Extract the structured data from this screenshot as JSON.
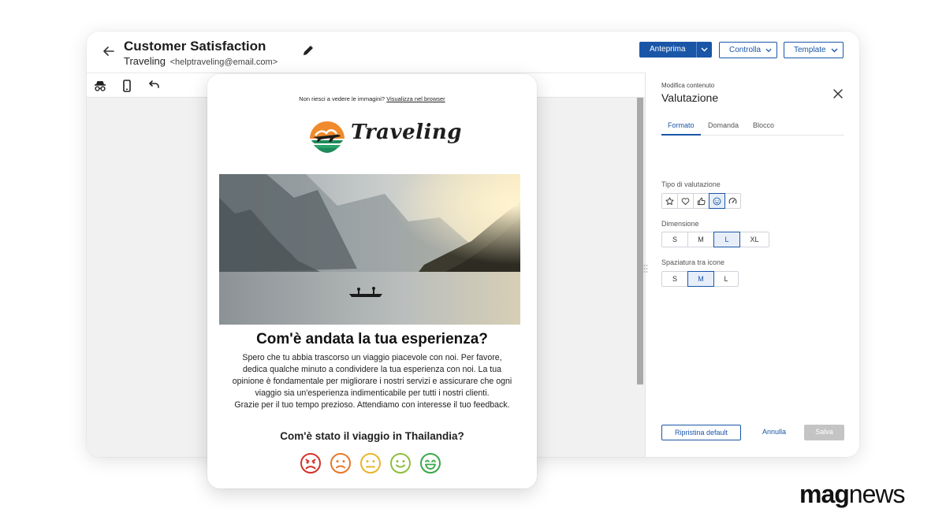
{
  "header": {
    "title": "Customer Satisfaction",
    "sender_name": "Traveling",
    "sender_email": "<helptraveling@email.com>",
    "preview_label": "Anteprima",
    "check_label": "Controlla",
    "template_label": "Template"
  },
  "panel": {
    "subtitle": "Modifica contenuto",
    "title": "Valutazione",
    "tabs": [
      "Formato",
      "Domanda",
      "Blocco"
    ],
    "active_tab": "Formato",
    "rating_type_label": "Tipo di valutazione",
    "rating_types": [
      "star-icon",
      "heart-icon",
      "thumbs-up-icon",
      "smiley-icon",
      "gauge-icon"
    ],
    "rating_type_selected": "smiley-icon",
    "size_label": "Dimensione",
    "sizes": [
      "S",
      "M",
      "L",
      "XL"
    ],
    "size_selected": "L",
    "spacing_label": "Spaziatura tra icone",
    "spacings": [
      "S",
      "M",
      "L"
    ],
    "spacing_selected": "M",
    "reset_label": "Ripristina default",
    "cancel_label": "Annulla",
    "save_label": "Salva"
  },
  "email": {
    "browser_text": "Non riesci a vedere le immagini?",
    "browser_link": "Visualizza nel browser",
    "logo_text": "Traveling",
    "headline": "Com'è andata la tua esperienza?",
    "body_lines": [
      "Spero che tu abbia trascorso un viaggio piacevole con noi. Per favore,",
      "dedica qualche minuto a condividere la tua esperienza con noi. La tua",
      "opinione è fondamentale per migliorare i nostri servizi e assicurare che ogni",
      "viaggio sia un'esperienza indimenticabile per tutti i nostri clienti.",
      "Grazie per il tuo tempo prezioso. Attendiamo con interesse il tuo feedback."
    ],
    "question": "Com'è stato il viaggio in Thailandia?",
    "faces": [
      {
        "icon": "very-sad-face-icon",
        "color": "#d2332a"
      },
      {
        "icon": "sad-face-icon",
        "color": "#e8782a"
      },
      {
        "icon": "neutral-face-icon",
        "color": "#e9b52a"
      },
      {
        "icon": "happy-face-icon",
        "color": "#8cbf3f"
      },
      {
        "icon": "very-happy-face-icon",
        "color": "#3aa84a"
      }
    ]
  },
  "brand": {
    "part1": "mag",
    "part2": "news"
  },
  "colors": {
    "accent": "#1a56a8",
    "canvas": "#f1f1f1",
    "save_disabled": "#c4c4c4"
  }
}
